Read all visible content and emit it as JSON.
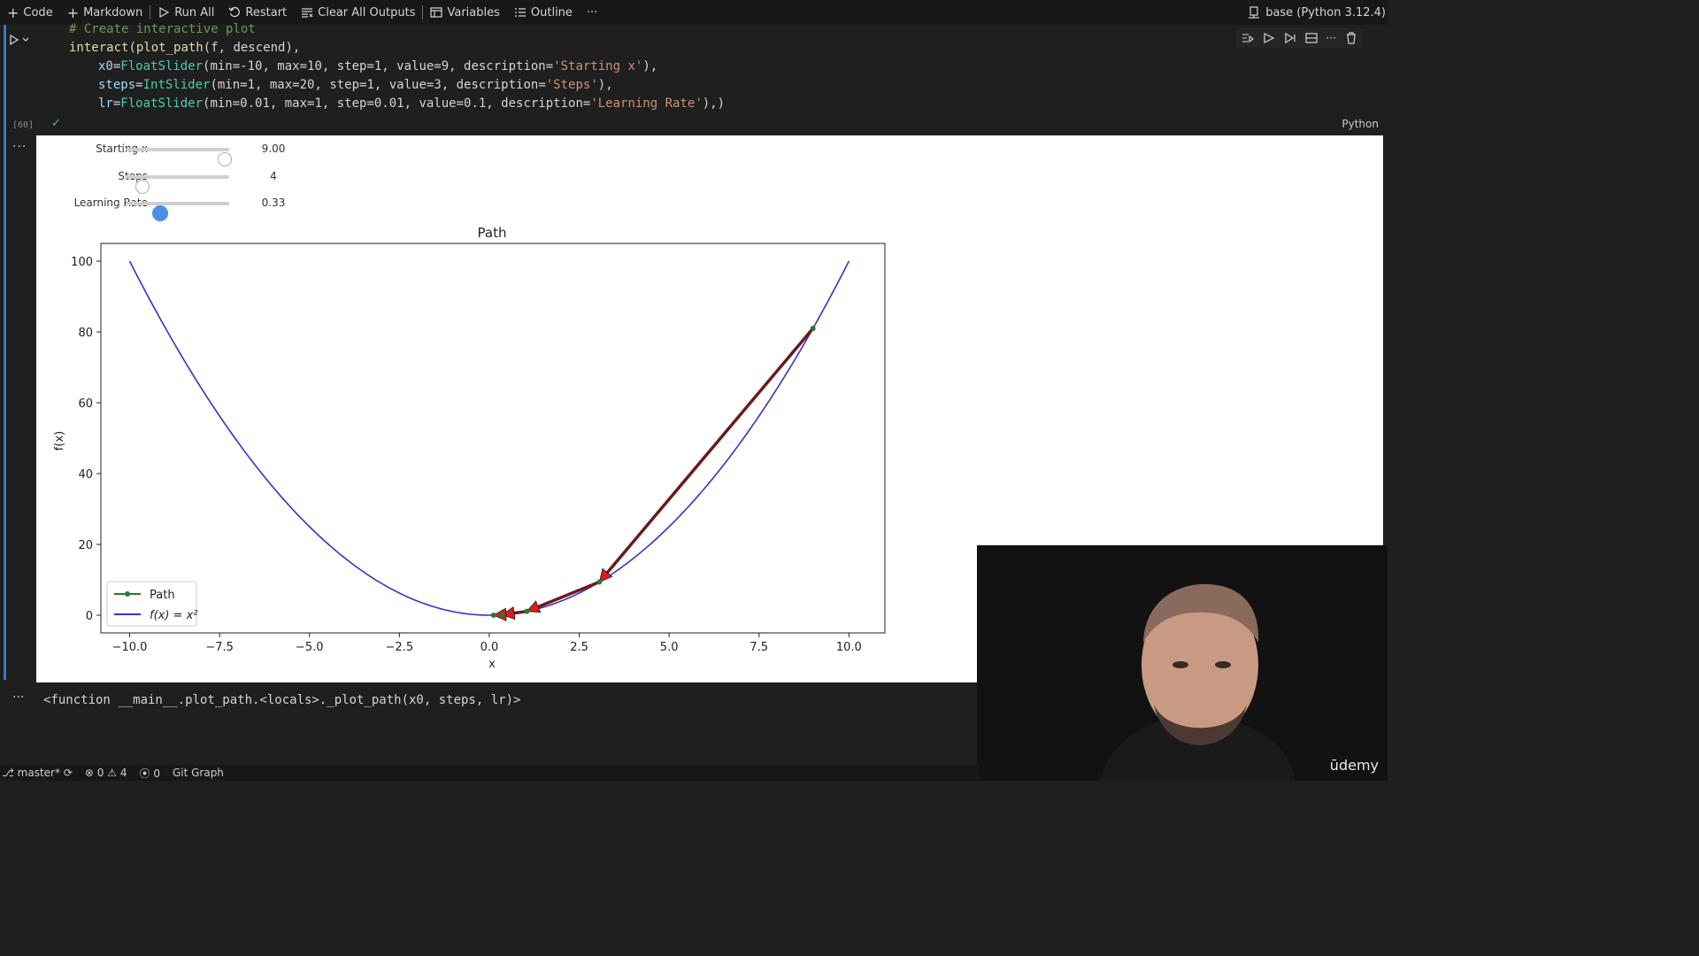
{
  "toolbar": {
    "code": "Code",
    "markdown": "Markdown",
    "run_all": "Run All",
    "restart": "Restart",
    "clear_outputs": "Clear All Outputs",
    "variables": "Variables",
    "outline": "Outline",
    "more": "···",
    "kernel": "base (Python 3.12.4)"
  },
  "cell": {
    "exec_count": "[60]",
    "language": "Python",
    "lines": {
      "l1": "# Create interactive plot",
      "l2a": "interact",
      "l2b": "(",
      "l2c": "plot_path",
      "l2d": "(f, descend),",
      "l3a": "x0",
      "l3b": "=",
      "l3c": "FloatSlider",
      "l3d": "(min=-10, max=10, step=1, value=9, description=",
      "l3e": "'Starting x'",
      "l3f": "),",
      "l4a": "steps",
      "l4b": "=",
      "l4c": "IntSlider",
      "l4d": "(min=1, max=20, step=1, value=3, description=",
      "l4e": "'Steps'",
      "l4f": "),",
      "l5a": "lr",
      "l5b": "=",
      "l5c": "FloatSlider",
      "l5d": "(min=0.01, max=1, step=0.01, value=0.1, description=",
      "l5e": "'Learning Rate'",
      "l5f": "),)"
    }
  },
  "widgets": [
    {
      "label": "Starting x",
      "value_text": "9.00",
      "value": 9,
      "min": -10,
      "max": 10
    },
    {
      "label": "Steps",
      "value_text": "4",
      "value": 4,
      "min": 1,
      "max": 20
    },
    {
      "label": "Learning Rate",
      "value_text": "0.33",
      "value": 0.33,
      "min": 0.01,
      "max": 1
    }
  ],
  "output_text": "<function __main__.plot_path.<locals>._plot_path(x0, steps, lr)>",
  "chart_data": {
    "type": "line",
    "title": "Path",
    "xlabel": "x",
    "ylabel": "f(x)",
    "xlim": [
      -10.8,
      11.0
    ],
    "ylim": [
      -5,
      105
    ],
    "xticks": [
      "−10.0",
      "−7.5",
      "−5.0",
      "−2.5",
      "0.0",
      "2.5",
      "5.0",
      "7.5",
      "10.0"
    ],
    "yticks": [
      "0",
      "20",
      "40",
      "60",
      "80",
      "100"
    ],
    "legend_position": "lower-left",
    "series": [
      {
        "name": "Path",
        "color": "#2a7a2a",
        "x": [
          9.0,
          3.06,
          1.04,
          0.35,
          0.12
        ],
        "y": [
          81.0,
          9.36,
          1.08,
          0.12,
          0.01
        ]
      },
      {
        "name": "f(x) = x²",
        "color": "#3b2fc9",
        "function": "x^2",
        "x_range": [
          -10,
          10
        ]
      }
    ],
    "arrow_color": "#d42020",
    "arrow_line_color": "#6a1a1a"
  },
  "status": {
    "branch": "master*",
    "errors": "0",
    "warnings": "4",
    "ports": "0",
    "git_graph": "Git Graph"
  },
  "webcam": {
    "brand": "ūdemy"
  }
}
